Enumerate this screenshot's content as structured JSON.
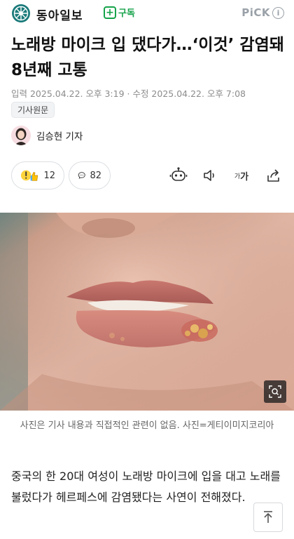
{
  "header": {
    "brand": "동아일보",
    "subscribe_label": "구독",
    "pick_label": "PiCK",
    "pick_info_symbol": "i"
  },
  "article": {
    "title": "노래방 마이크 입 댔다가…‘이것’ 감염돼 8년째 고통",
    "dates": "입력 2025.04.22. 오후 3:19 · 수정 2025.04.22. 오후 7:08",
    "source_chip": "기사원문",
    "reporter": "김승현 기자",
    "image_caption": "사진은 기사 내용과 직접적인 관련이 없음. 사진=게티이미지코리아",
    "body_first_paragraph": "중국의 한 20대 여성이 노래방 마이크에 입을 대고 노래를 불렀다가 헤르페스에 감염됐다는 사연이 전해졌다."
  },
  "reactions": {
    "like_count": "12",
    "comment_count": "82"
  },
  "toolbar": {
    "font_small": "가",
    "font_large": "가"
  },
  "colors": {
    "brand_green": "#16a34a",
    "logo_teal": "#1b7a7a",
    "muted_text": "#8c8c8c"
  }
}
